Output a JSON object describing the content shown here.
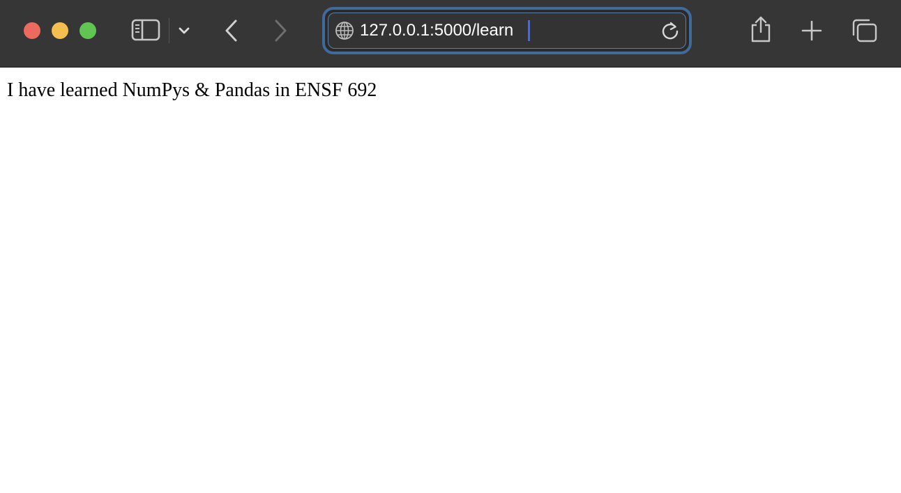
{
  "browser": {
    "url": "127.0.0.1:5000/learn",
    "accent_color": "#3f6a9a",
    "toolbar_color": "#363636",
    "traffic_lights": {
      "close_color": "#ed6a5e",
      "minimize_color": "#f5bf4f",
      "maximize_color": "#61c554"
    },
    "icons": {
      "sidebar": "sidebar-icon",
      "tab_menu": "chevron-down-icon",
      "back": "chevron-left-icon",
      "forward": "chevron-right-icon",
      "site": "globe-icon",
      "reload": "reload-icon",
      "share": "share-icon",
      "new_tab": "plus-icon",
      "tab_overview": "tabs-overview-icon"
    }
  },
  "page": {
    "text": "I have learned NumPys & Pandas in ENSF 692"
  }
}
